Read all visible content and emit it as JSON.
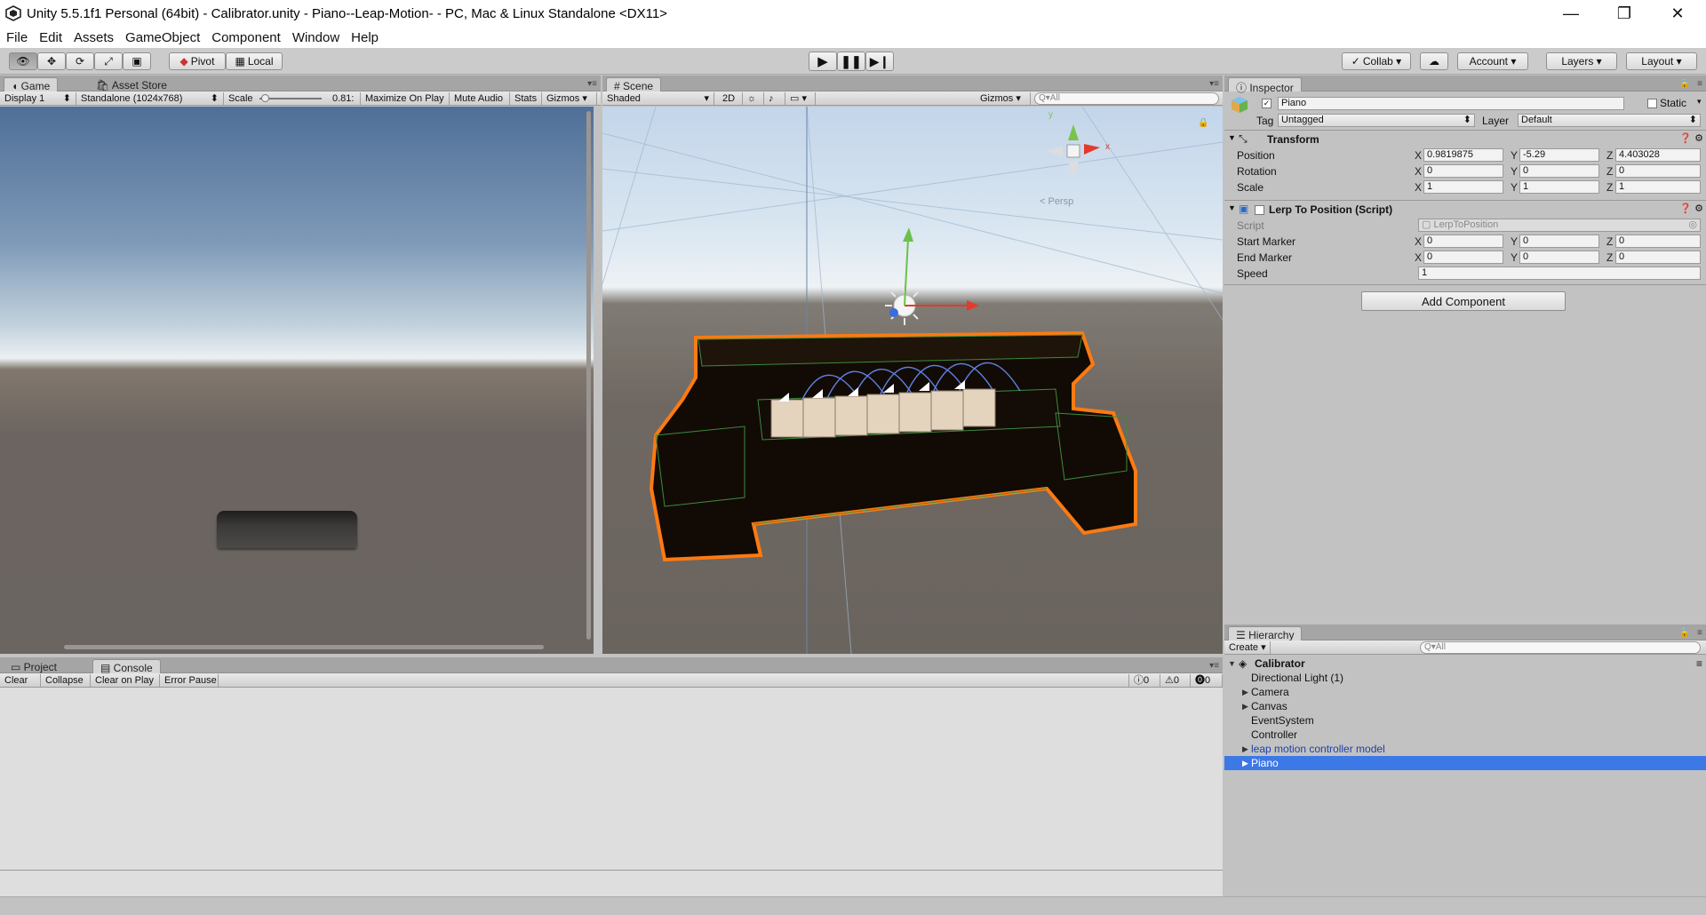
{
  "window": {
    "title": "Unity 5.5.1f1 Personal (64bit) - Calibrator.unity - Piano--Leap-Motion- - PC, Mac & Linux Standalone <DX11>",
    "minimize": "—",
    "maximize": "❐",
    "close": "✕"
  },
  "menu": [
    "File",
    "Edit",
    "Assets",
    "GameObject",
    "Component",
    "Window",
    "Help"
  ],
  "toolbar": {
    "pivot": "Pivot",
    "local": "Local",
    "collab": "Collab ▾",
    "account": "Account ▾",
    "layers": "Layers ▾",
    "layout": "Layout ▾"
  },
  "game": {
    "tab": "Game",
    "tab2": "Asset Store",
    "display": "Display 1",
    "resolution": "Standalone (1024x768)",
    "scale_label": "Scale",
    "scale_value": "0.81:",
    "maximize": "Maximize On Play",
    "mute": "Mute Audio",
    "stats": "Stats",
    "gizmos": "Gizmos"
  },
  "scene": {
    "tab": "Scene",
    "shading": "Shaded",
    "mode2d": "2D",
    "gizmos": "Gizmos",
    "search": "Q▾All",
    "persp": "< Persp"
  },
  "inspector": {
    "tab": "Inspector",
    "object_name": "Piano",
    "static_label": "Static",
    "tag_label": "Tag",
    "tag_value": "Untagged",
    "layer_label": "Layer",
    "layer_value": "Default",
    "transform": {
      "title": "Transform",
      "rows": [
        {
          "label": "Position",
          "x": "0.9819875",
          "y": "-5.29",
          "z": "4.403028"
        },
        {
          "label": "Rotation",
          "x": "0",
          "y": "0",
          "z": "0"
        },
        {
          "label": "Scale",
          "x": "1",
          "y": "1",
          "z": "1"
        }
      ]
    },
    "script": {
      "title": "Lerp To Position (Script)",
      "script_label": "Script",
      "script_value": "LerpToPosition",
      "start_label": "Start Marker",
      "start": {
        "x": "0",
        "y": "0",
        "z": "0"
      },
      "end_label": "End Marker",
      "end": {
        "x": "0",
        "y": "0",
        "z": "0"
      },
      "speed_label": "Speed",
      "speed": "1"
    },
    "add_component": "Add Component"
  },
  "hierarchy": {
    "tab": "Hierarchy",
    "create": "Create ▾",
    "search": "Q▾All",
    "scene": "Calibrator",
    "items": [
      {
        "label": "Directional Light (1)",
        "expandable": false,
        "selected": false
      },
      {
        "label": "Camera",
        "expandable": true,
        "selected": false
      },
      {
        "label": "Canvas",
        "expandable": true,
        "selected": false
      },
      {
        "label": "EventSystem",
        "expandable": false,
        "selected": false
      },
      {
        "label": "Controller",
        "expandable": false,
        "selected": false
      },
      {
        "label": "leap motion controller model",
        "expandable": true,
        "selected": false
      },
      {
        "label": "Piano",
        "expandable": true,
        "selected": true
      }
    ]
  },
  "bottom": {
    "tab_project": "Project",
    "tab_console": "Console",
    "clear": "Clear",
    "collapse": "Collapse",
    "clear_on_play": "Clear on Play",
    "error_pause": "Error Pause",
    "info_count": "0",
    "warn_count": "0",
    "error_count": "0"
  },
  "colors": {
    "selection": "#3c78e6",
    "outline": "#ff7a12",
    "editor_bg": "#c2c2c2"
  }
}
